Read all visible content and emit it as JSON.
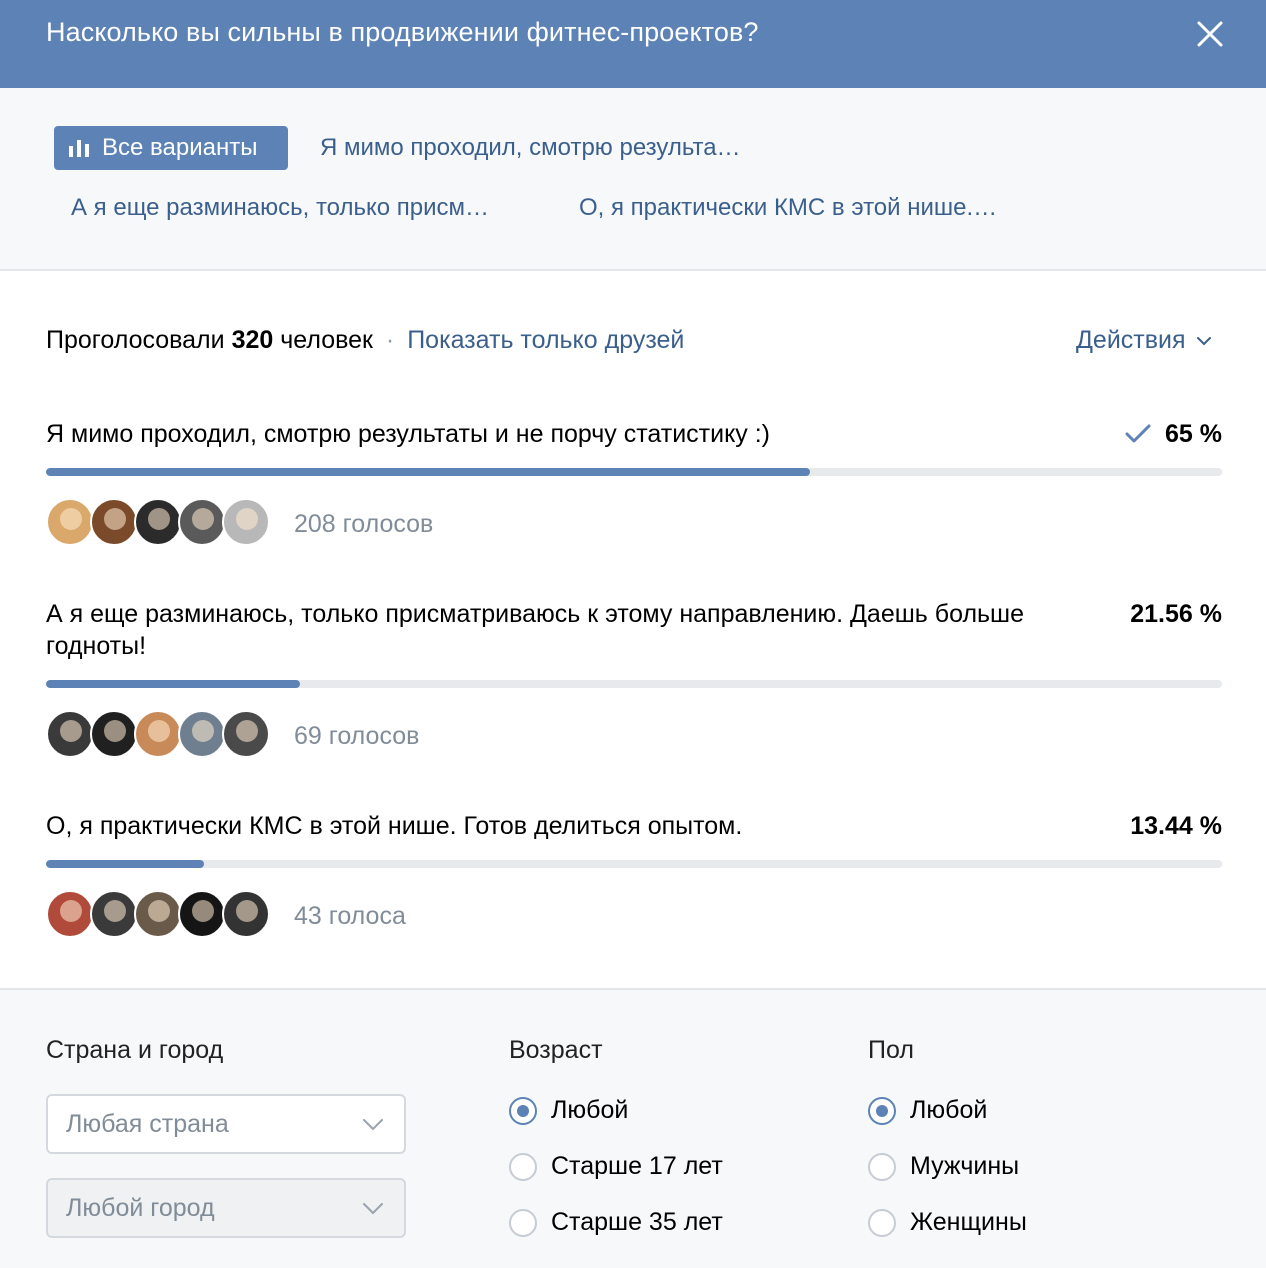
{
  "header": {
    "title": "Насколько вы сильны в продвижении фитнес-проектов?",
    "close_icon": "close-icon"
  },
  "tabs": [
    {
      "label": "Все варианты",
      "active": true,
      "icon": "bar-chart-icon"
    },
    {
      "label": "Я мимо проходил, смотрю результа…",
      "active": false
    },
    {
      "label": "А я еще разминаюсь, только присм…",
      "active": false
    },
    {
      "label": "О, я практически КМС в этой нише.…",
      "active": false
    }
  ],
  "summary": {
    "prefix": "Проголосовали",
    "count": "320",
    "suffix": "человек",
    "separator": "·",
    "friends_link": "Показать только друзей",
    "actions_label": "Действия"
  },
  "options": [
    {
      "text": "Я мимо проходил, смотрю результаты и не порчу статистику :)",
      "percent_label": "65 %",
      "percent": 65,
      "voted": true,
      "votes_label": "208 голосов"
    },
    {
      "text": "А я еще разминаюсь, только присматриваюсь к этому направлению. Даешь больше годноты!",
      "percent_label": "21.56 %",
      "percent": 21.56,
      "voted": false,
      "votes_label": "69 голосов"
    },
    {
      "text": "О, я практически КМС в этой нише. Готов делиться опытом.",
      "percent_label": "13.44 %",
      "percent": 13.44,
      "voted": false,
      "votes_label": "43 голоса"
    }
  ],
  "filters": {
    "location": {
      "title": "Страна и город",
      "country_value": "Любая страна",
      "city_value": "Любой город"
    },
    "age": {
      "title": "Возраст",
      "options": [
        "Любой",
        "Старше 17 лет",
        "Старше 35 лет"
      ],
      "selected": 0
    },
    "gender": {
      "title": "Пол",
      "options": [
        "Любой",
        "Мужчины",
        "Женщины"
      ],
      "selected": 0
    }
  },
  "colors": {
    "accent": "#5c82b6",
    "link": "#3b5f8c",
    "muted": "#818c99",
    "avatars": [
      [
        "#d9a86a",
        "#7a4a2a",
        "#2b2b2b",
        "#5a5a5a",
        "#b8b8b8"
      ],
      [
        "#3a3a3a",
        "#202020",
        "#c98a5a",
        "#6f7f90",
        "#4a4a4a"
      ],
      [
        "#b04a3a",
        "#3a3a3a",
        "#6a5a4a",
        "#151515",
        "#333333"
      ]
    ]
  }
}
